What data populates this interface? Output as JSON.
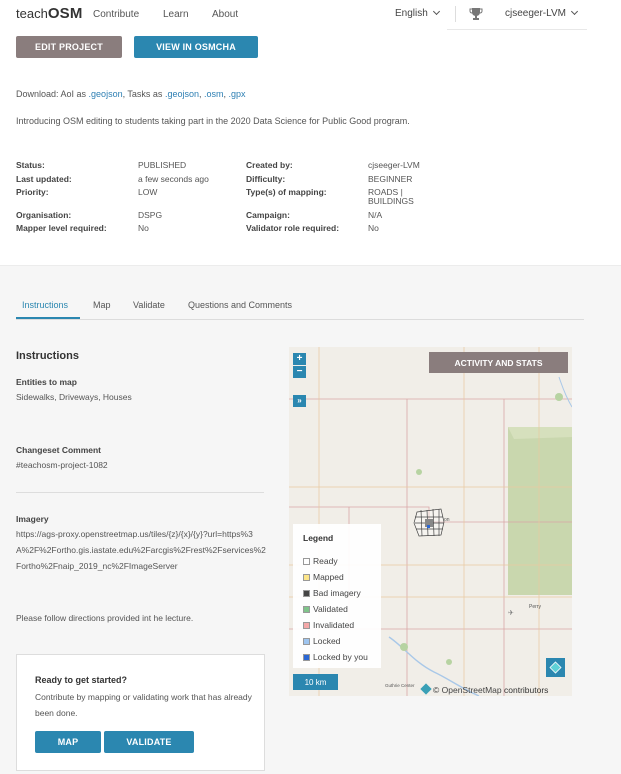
{
  "header": {
    "logo_light": "teach",
    "logo_bold": "OSM",
    "nav": [
      "Contribute",
      "Learn",
      "About"
    ],
    "language": "English",
    "username": "cjseeger-LVM",
    "trophy_icon": "trophy-icon"
  },
  "actions": {
    "edit_project": "EDIT PROJECT",
    "view_osmcha": "VIEW IN OSMCHA"
  },
  "download": {
    "prefix": "Download: AoI as ",
    "aoi_geojson": ".geojson",
    "tasks_prefix": ", Tasks as ",
    "tasks_geojson": ".geojson",
    "comma1": ", ",
    "tasks_osm": ".osm",
    "comma2": ", ",
    "tasks_gpx": ".gpx"
  },
  "description": "Introducing OSM editing to students taking part in the 2020 Data Science for Public Good program.",
  "meta": {
    "status_label": "Status:",
    "status": "PUBLISHED",
    "updated_label": "Last updated:",
    "updated": "a few seconds ago",
    "priority_label": "Priority:",
    "priority": "LOW",
    "org_label": "Organisation:",
    "org": "DSPG",
    "mapper_level_label": "Mapper level required:",
    "mapper_level": "No",
    "created_label": "Created by:",
    "created": "cjseeger-LVM",
    "difficulty_label": "Difficulty:",
    "difficulty": "BEGINNER",
    "mapping_types_label": "Type(s) of mapping:",
    "mapping_types_1": "ROADS |",
    "mapping_types_2": "BUILDINGS",
    "campaign_label": "Campaign:",
    "campaign": "N/A",
    "validator_label": "Validator role required:",
    "validator": "No"
  },
  "tabs": [
    "Instructions",
    "Map",
    "Validate",
    "Questions and Comments"
  ],
  "instructions": {
    "heading": "Instructions",
    "entities_label": "Entities to map",
    "entities": "Sidewalks, Driveways, Houses",
    "changeset_label": "Changeset Comment",
    "changeset": "#teachosm-project-1082",
    "imagery_label": "Imagery",
    "imagery": "https://ags-proxy.openstreetmap.us/tiles/{z}/{x}/{y}?url=https%3A%2F%2Fortho.gis.iastate.edu%2Farcgis%2Frest%2Fservices%2Fortho%2Fnaip_2019_nc%2FImageServer",
    "note": "Please follow directions provided int he lecture."
  },
  "start_card": {
    "title": "Ready to get started?",
    "text": "Contribute by mapping or validating work that has already been done.",
    "map_button": "MAP",
    "validate_button": "VALIDATE"
  },
  "map": {
    "zoom_in": "+",
    "zoom_out": "−",
    "expand": "»",
    "activity_button": "ACTIVITY AND STATS",
    "legend_title": "Legend",
    "legend": [
      {
        "label": "Ready",
        "color": "#ffffff"
      },
      {
        "label": "Mapped",
        "color": "#fde68a"
      },
      {
        "label": "Bad imagery",
        "color": "#444444"
      },
      {
        "label": "Validated",
        "color": "#7fc48a"
      },
      {
        "label": "Invalidated",
        "color": "#f4a8a8"
      },
      {
        "label": "Locked",
        "color": "#9ec5f0"
      },
      {
        "label": "Locked by you",
        "color": "#2b67d4"
      }
    ],
    "scale": "10 km",
    "attribution_prefix": "© OpenStreetMap",
    "attribution_suffix": " contributors",
    "place_labels": [
      "Perry",
      "Guthrie Center",
      "on"
    ]
  },
  "colors": {
    "accent": "#2b87b0",
    "secondary": "#8a7d7d"
  }
}
